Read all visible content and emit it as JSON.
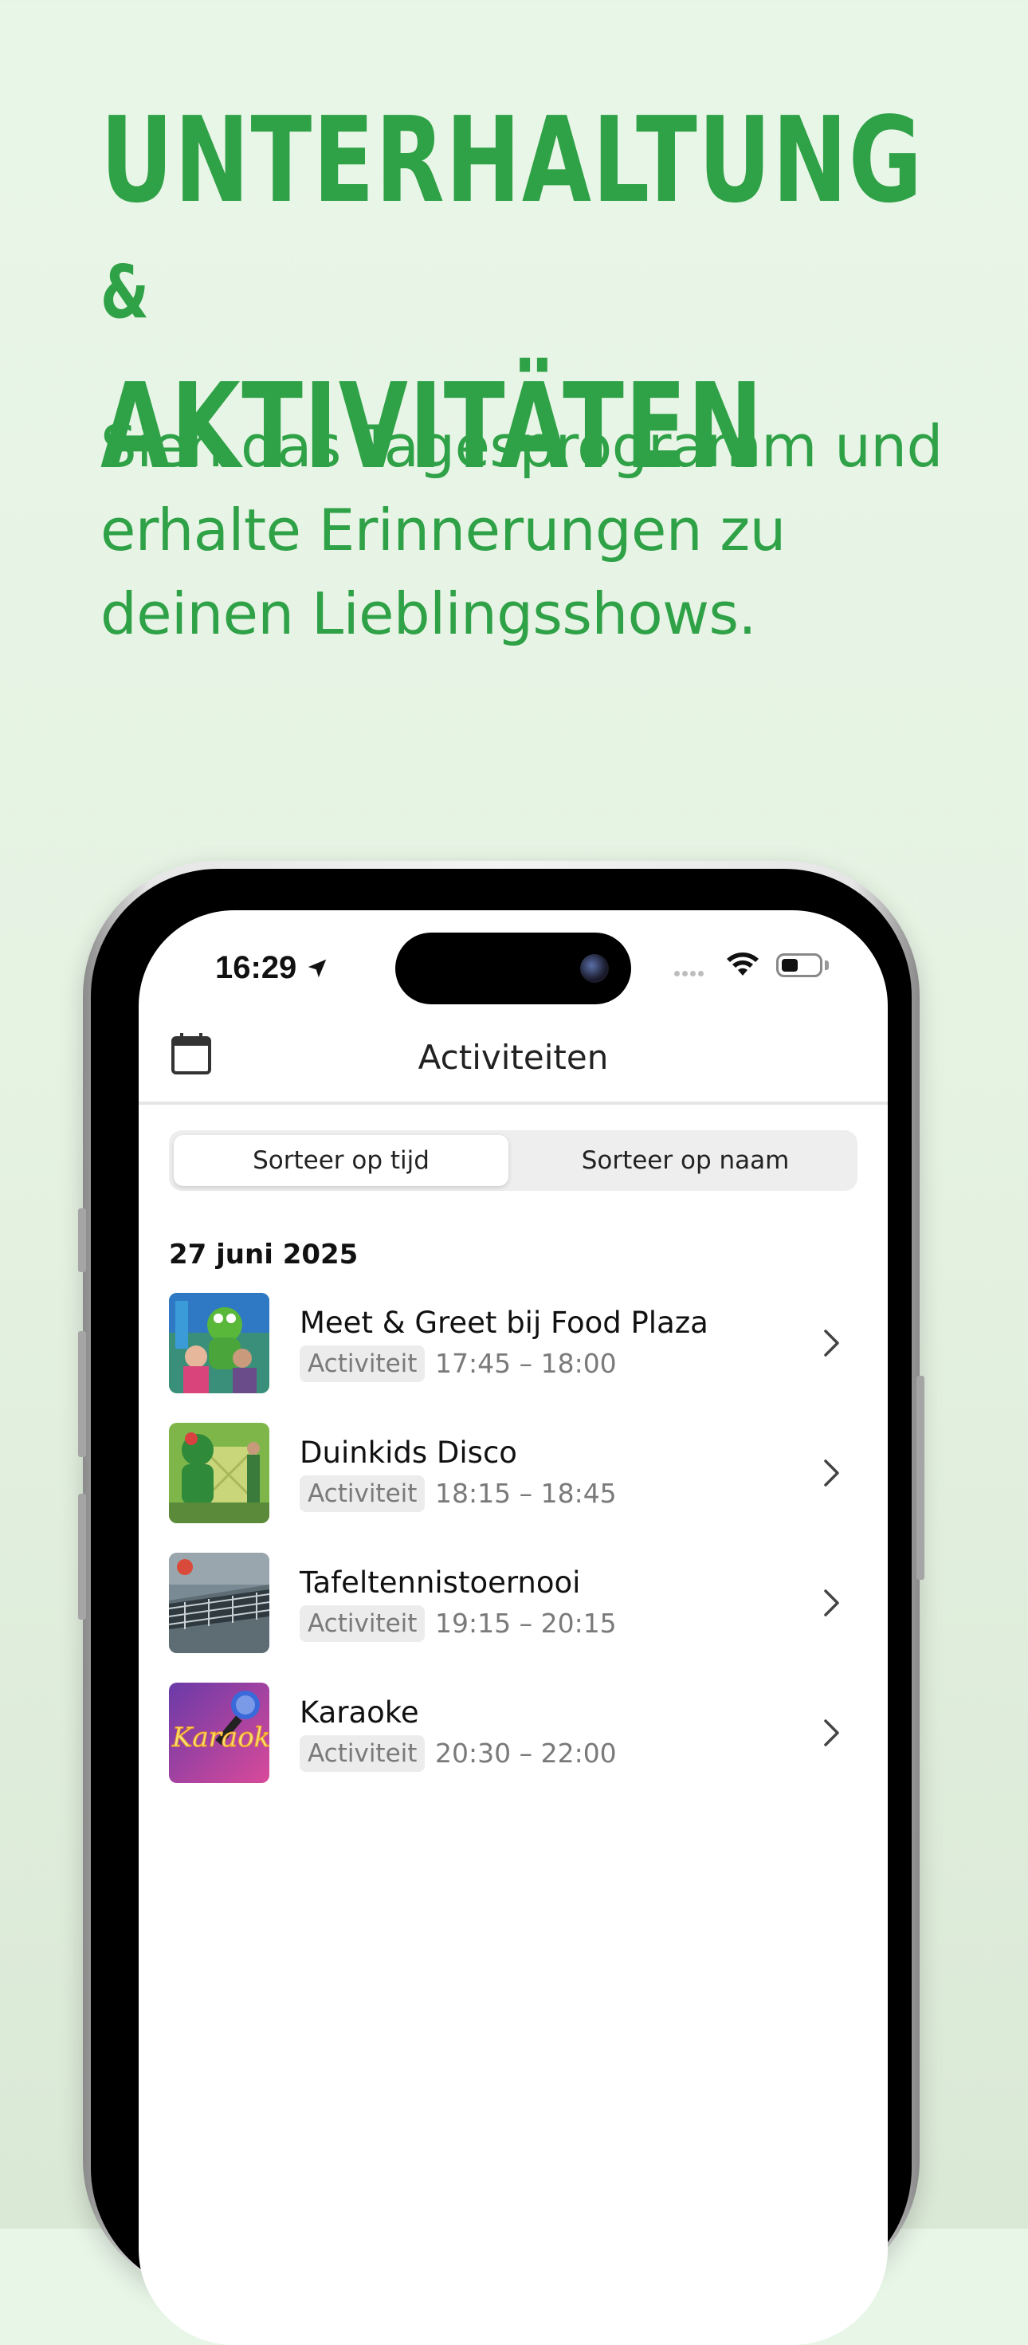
{
  "promo": {
    "headline_line1": "UNTERHALTUNG",
    "headline_amp": "&",
    "headline_line2": "AKTIVITÄTEN",
    "subhead": "Sieh das Tagesprogramm und erhalte Erinnerungen zu deinen Lieblingsshows."
  },
  "status_bar": {
    "time": "16:29"
  },
  "nav": {
    "title": "Activiteiten",
    "calendar_icon": "calendar-icon"
  },
  "sort": {
    "by_time": "Sorteer op tijd",
    "by_name": "Sorteer op naam",
    "selected": "by_time"
  },
  "date_header": "27 juni 2025",
  "activities": [
    {
      "name": "Meet & Greet bij Food Plaza",
      "category": "Activiteit",
      "time": "17:45 – 18:00"
    },
    {
      "name": "Duinkids Disco",
      "category": "Activiteit",
      "time": "18:15 – 18:45"
    },
    {
      "name": "Tafeltennistoernooi",
      "category": "Activiteit",
      "time": "19:15 – 20:15"
    },
    {
      "name": "Karaoke",
      "category": "Activiteit",
      "time": "20:30 – 22:00"
    }
  ],
  "colors": {
    "brand_green": "#2fa146",
    "background": "#e8f6e8"
  }
}
